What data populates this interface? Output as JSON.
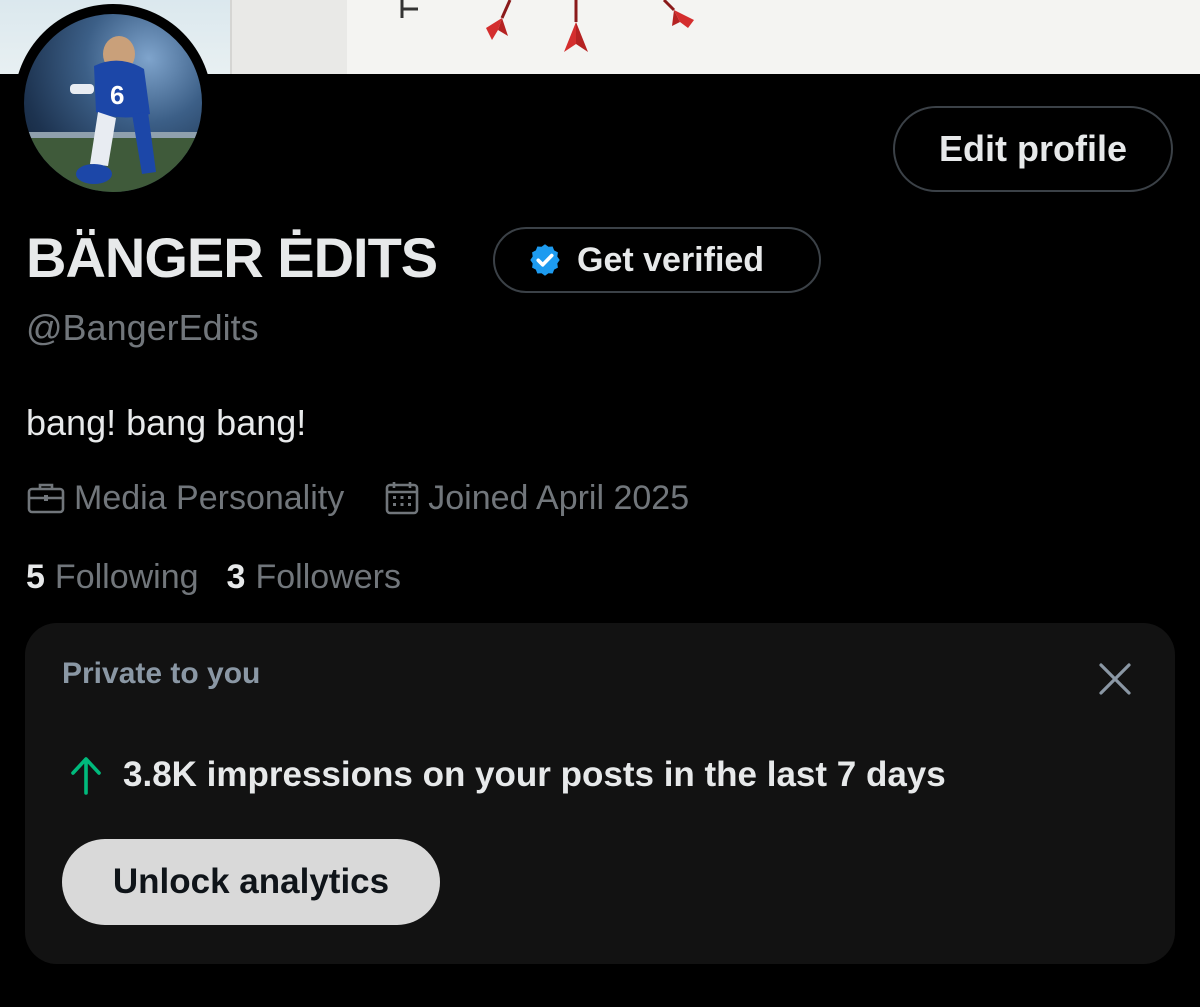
{
  "profile": {
    "display_name": "BÄNGER ĖDITS",
    "handle": "@BangerEdits",
    "bio": "bang! bang bang!",
    "category": "Media Personality",
    "joined": "Joined April 2025",
    "following_count": "5",
    "following_label": "Following",
    "followers_count": "3",
    "followers_label": "Followers"
  },
  "buttons": {
    "edit_profile": "Edit profile",
    "get_verified": "Get verified"
  },
  "private_card": {
    "title": "Private to you",
    "stat_text": "3.8K impressions on your posts in the last 7 days",
    "cta": "Unlock analytics"
  },
  "icons": {
    "category": "briefcase-icon",
    "joined": "calendar-icon",
    "verified": "verified-badge-icon",
    "trend": "arrow-up-icon",
    "close": "close-icon"
  },
  "colors": {
    "background": "#000000",
    "primary_text": "#e7e9ea",
    "secondary_text": "#71767b",
    "verified_blue": "#1d9bf0",
    "trend_green": "#00ba7c",
    "card_bg": "#121212"
  }
}
